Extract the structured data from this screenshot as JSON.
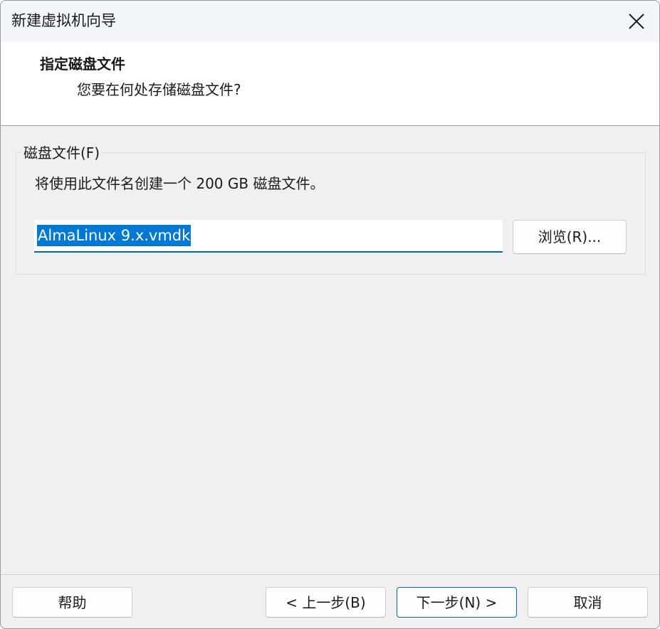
{
  "window": {
    "title": "新建虚拟机向导",
    "close_icon": "close-icon"
  },
  "header": {
    "title": "指定磁盘文件",
    "subtitle": "您要在何处存储磁盘文件?"
  },
  "disk_file": {
    "group_label": "磁盘文件(F)",
    "description": "将使用此文件名创建一个 200 GB 磁盘文件。",
    "filename_value": "AlmaLinux 9.x.vmdk",
    "browse_label": "浏览(R)..."
  },
  "footer": {
    "help_label": "帮助",
    "back_label": "< 上一步(B)",
    "next_label": "下一步(N) >",
    "cancel_label": "取消"
  },
  "colors": {
    "accent": "#0067c0",
    "selection": "#0078d4",
    "titlebar_bg": "#f2f5f9",
    "body_bg": "#f0f0f0"
  }
}
